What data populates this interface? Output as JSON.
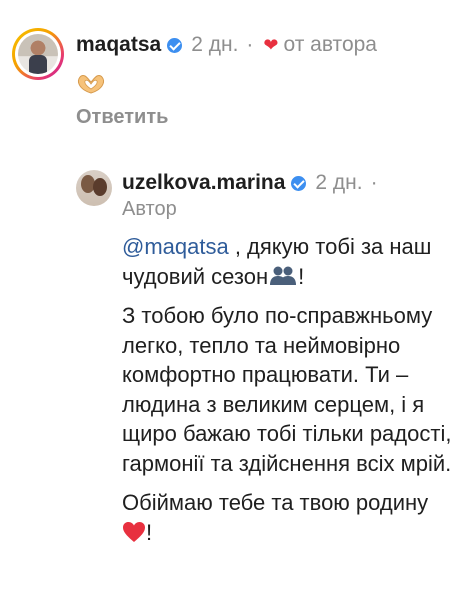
{
  "top_comment": {
    "username": "maqatsa",
    "time": "2 дн.",
    "separator": "·",
    "author_liked": "от автора",
    "reply_label": "Ответить"
  },
  "reply_comment": {
    "username": "uzelkova.marina",
    "time": "2 дн.",
    "separator": "·",
    "author_tag": "Автор",
    "mention": "@maqatsa",
    "line1_text": " , дякую тобі за наш чудовий сезон",
    "line1_end": "!",
    "paragraph2": "З тобою було по-справжньому легко, тепло та неймовірно комфортно працювати. Ти – людина з великим серцем, і я щиро бажаю тобі тільки радості, гармонії та здійснення всіх мрій.",
    "paragraph3_text": "Обіймаю тебе та твою родину",
    "paragraph3_end": "!"
  },
  "colors": {
    "verified": "#3d8ff0",
    "heart": "#e8303f",
    "mention": "#2f5c9a",
    "muted": "#8e8e8e"
  },
  "icons": {
    "verified": "verified-badge-icon",
    "heart": "heart-icon",
    "hands": "heart-hands-emoji",
    "people": "people-silhouette-emoji",
    "red_heart": "red-heart-emoji"
  }
}
